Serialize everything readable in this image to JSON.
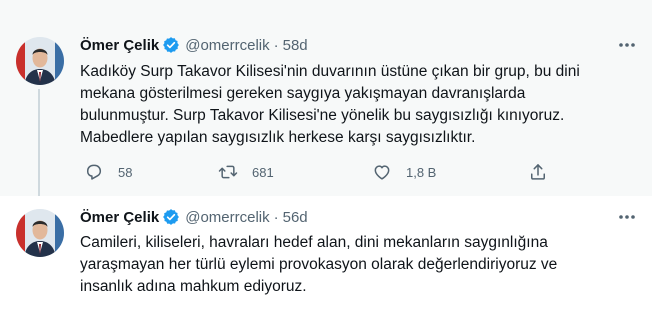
{
  "tweets": [
    {
      "author_name": "Ömer Çelik",
      "handle": "@omerrcelik",
      "separator": "·",
      "time": "58d",
      "text_lines": [
        "Kadıköy Surp Takavor Kilisesi'nin duvarının üstüne çıkan bir grup, bu dini",
        "mekana gösterilmesi gereken saygıya yakışmayan davranışlarda",
        "bulunmuştur. Surp Takavor Kilisesi'ne yönelik bu saygısızlığı kınıyoruz.",
        "Mabedlere yapılan saygısızlık herkese karşı saygısızlıktır."
      ],
      "replies": "58",
      "retweets": "681",
      "likes": "1,8 B"
    },
    {
      "author_name": "Ömer Çelik",
      "handle": "@omerrcelik",
      "separator": "·",
      "time": "56d",
      "text_lines": [
        "Camileri, kiliseleri, havraları hedef alan, dini mekanların saygınlığına",
        "yaraşmayan her türlü eylemi provokasyon olarak değerlendiriyoruz ve",
        "insanlık adına mahkum ediyoruz."
      ]
    }
  ],
  "colors": {
    "verified_blue": "#1d9bf0",
    "muted_text": "#536471",
    "thread_line": "#cfd9de"
  },
  "icons": {
    "verified": "verified-badge-icon",
    "more": "more-horizontal-icon",
    "reply": "reply-icon",
    "retweet": "retweet-icon",
    "like": "heart-icon",
    "share": "share-icon"
  }
}
